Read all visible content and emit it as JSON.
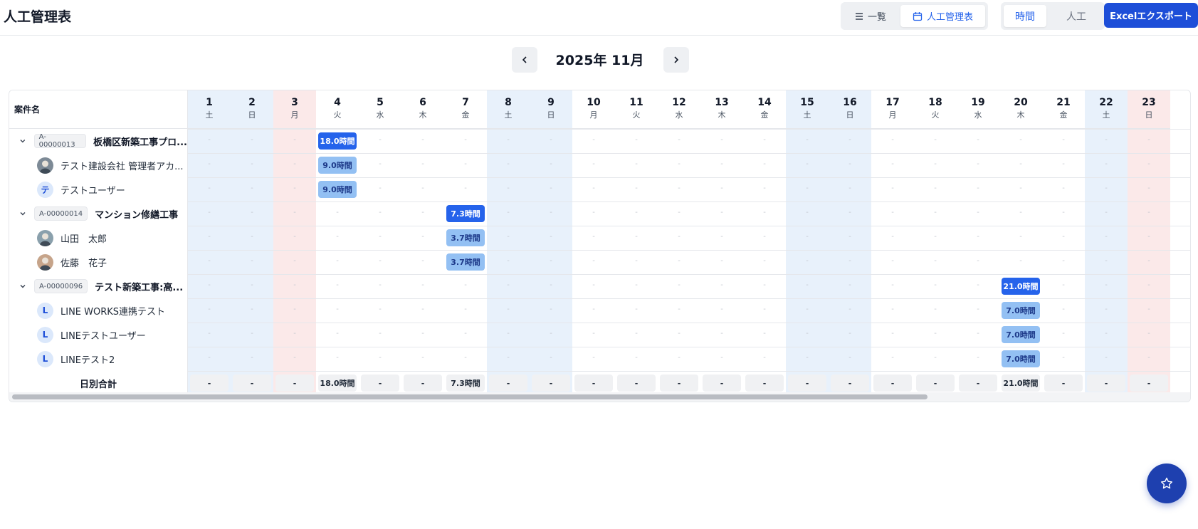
{
  "page": {
    "title": "人工管理表"
  },
  "view_modes": [
    {
      "label": "一覧",
      "icon": "list-icon",
      "active": false
    },
    {
      "label": "人工管理表",
      "icon": "calendar-icon",
      "active": true
    }
  ],
  "unit_toggle": [
    {
      "label": "時間",
      "active": true
    },
    {
      "label": "人工",
      "active": false
    }
  ],
  "export_button": "Excelエクスポート",
  "month_nav": {
    "label": "2025年 11月"
  },
  "table": {
    "name_header": "案件名",
    "days": [
      {
        "d": "1",
        "w": "土",
        "type": "sat"
      },
      {
        "d": "2",
        "w": "日",
        "type": "sun-blue"
      },
      {
        "d": "3",
        "w": "月",
        "type": "holiday"
      },
      {
        "d": "4",
        "w": "火",
        "type": ""
      },
      {
        "d": "5",
        "w": "水",
        "type": ""
      },
      {
        "d": "6",
        "w": "木",
        "type": ""
      },
      {
        "d": "7",
        "w": "金",
        "type": ""
      },
      {
        "d": "8",
        "w": "土",
        "type": "sat"
      },
      {
        "d": "9",
        "w": "日",
        "type": "sun-blue"
      },
      {
        "d": "10",
        "w": "月",
        "type": ""
      },
      {
        "d": "11",
        "w": "火",
        "type": ""
      },
      {
        "d": "12",
        "w": "水",
        "type": ""
      },
      {
        "d": "13",
        "w": "木",
        "type": ""
      },
      {
        "d": "14",
        "w": "金",
        "type": ""
      },
      {
        "d": "15",
        "w": "土",
        "type": "sat"
      },
      {
        "d": "16",
        "w": "日",
        "type": "sun-blue"
      },
      {
        "d": "17",
        "w": "月",
        "type": ""
      },
      {
        "d": "18",
        "w": "火",
        "type": ""
      },
      {
        "d": "19",
        "w": "水",
        "type": ""
      },
      {
        "d": "20",
        "w": "木",
        "type": ""
      },
      {
        "d": "21",
        "w": "金",
        "type": ""
      },
      {
        "d": "22",
        "w": "土",
        "type": "sat"
      },
      {
        "d": "23",
        "w": "日",
        "type": "holiday"
      }
    ],
    "rows": [
      {
        "kind": "project",
        "code": "A-00000013",
        "name": "板橋区新築工事プロ...",
        "hours": {
          "4": "18.0時間"
        }
      },
      {
        "kind": "person",
        "avatar": "photo1",
        "name": "テスト建設会社 管理者アカ...",
        "hours": {
          "4": "9.0時間"
        }
      },
      {
        "kind": "person",
        "avatar": "テ",
        "name": "テストユーザー",
        "hours": {
          "4": "9.0時間"
        }
      },
      {
        "kind": "project",
        "code": "A-00000014",
        "name": "マンション修繕工事",
        "hours": {
          "7": "7.3時間"
        }
      },
      {
        "kind": "person",
        "avatar": "photo2",
        "name": "山田　太郎",
        "hours": {
          "7": "3.7時間"
        }
      },
      {
        "kind": "person",
        "avatar": "photo3",
        "name": "佐藤　花子",
        "hours": {
          "7": "3.7時間"
        }
      },
      {
        "kind": "project",
        "code": "A-00000096",
        "name": "テスト新築工事:高...",
        "hours": {
          "20": "21.0時間"
        }
      },
      {
        "kind": "person",
        "avatar": "L",
        "name": "LINE WORKS連携テスト",
        "hours": {
          "20": "7.0時間"
        }
      },
      {
        "kind": "person",
        "avatar": "L",
        "name": "LINEテストユーザー",
        "hours": {
          "20": "7.0時間"
        }
      },
      {
        "kind": "person",
        "avatar": "L",
        "name": "LINEテスト2",
        "hours": {
          "20": "7.0時間"
        }
      }
    ],
    "totals_label": "日別合計",
    "totals": [
      "-",
      "-",
      "-",
      "18.0時間",
      "-",
      "-",
      "7.3時間",
      "-",
      "-",
      "-",
      "-",
      "-",
      "-",
      "-",
      "-",
      "-",
      "-",
      "-",
      "-",
      "21.0時間",
      "-",
      "-",
      "-"
    ],
    "empty_marker": "-"
  },
  "fab": {
    "icon": "star-icon"
  },
  "colors": {
    "accent": "#2563eb",
    "export_bg": "#1d4ed8",
    "project_badge": "#2563eb",
    "person_badge": "#93c0f3",
    "saturday_bg": "#e8f1fb",
    "holiday_bg": "#fbe9e9"
  }
}
